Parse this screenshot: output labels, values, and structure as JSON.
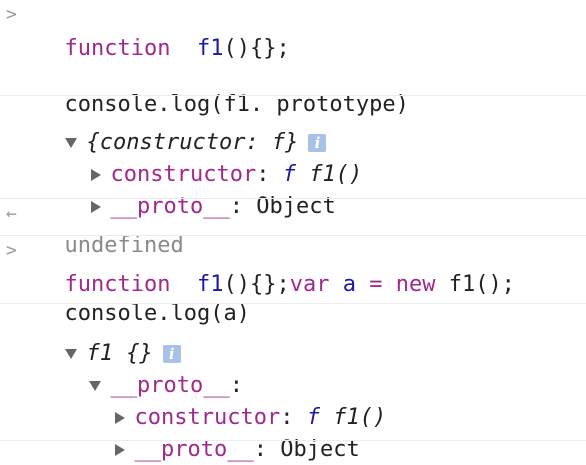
{
  "entries": [
    {
      "input_line1": {
        "kw": "function",
        "fn": "f1",
        "rest": "(){};"
      },
      "input_line2": "console.log(f1. prototype)",
      "output": {
        "summary": "{constructor: f}",
        "info": "i",
        "children": [
          {
            "name": "constructor",
            "colon": ":",
            "fsym": "f",
            "value": "f1()"
          },
          {
            "name": "__proto__",
            "colon": ":",
            "value": "Object"
          }
        ]
      },
      "return_value": "undefined"
    },
    {
      "input_line1": {
        "kw": "function",
        "fn": "f1",
        "rest": "(){};",
        "kw2": "var",
        "var": "a",
        "eq": "=",
        "kw3": "new",
        "call": "f1();"
      },
      "input_line2": "console.log(a)",
      "output": {
        "summary": "f1 {}",
        "info": "i",
        "proto_label": "__proto__",
        "proto_colon": ":",
        "children": [
          {
            "name": "constructor",
            "colon": ":",
            "fsym": "f",
            "value": "f1()"
          },
          {
            "name": "__proto__",
            "colon": ":",
            "value": "Object"
          }
        ]
      }
    }
  ],
  "icons": {
    "prompt": "chevron-right-icon",
    "return": "return-arrow-icon",
    "expanded": "triangle-down-icon",
    "collapsed": "triangle-right-icon",
    "info": "info-icon"
  },
  "colors": {
    "keyword": "#a1288d",
    "identifier": "#1a1aa6",
    "text": "#222222",
    "muted": "#8a8a8a",
    "info_badge": "#a7c2e6"
  }
}
